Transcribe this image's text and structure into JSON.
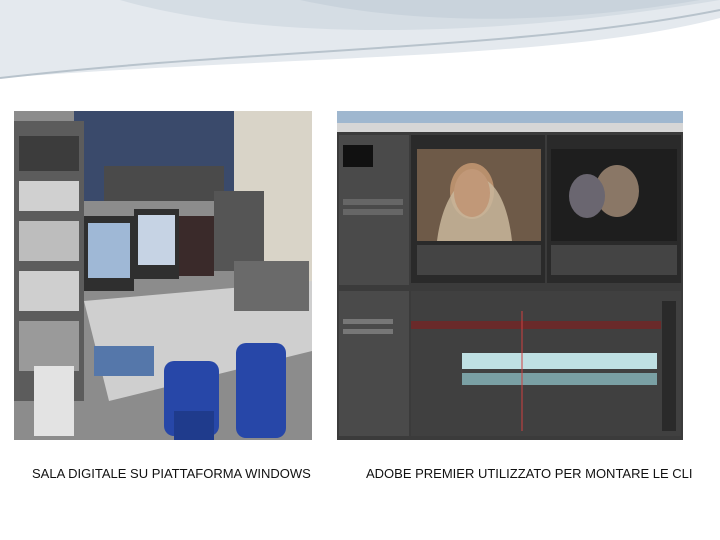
{
  "slide": {
    "images": [
      {
        "icon": "studio-photo-icon",
        "caption": "SALA DIGITALE SU PIATTAFORMA WINDOWS"
      },
      {
        "icon": "premiere-screenshot-icon",
        "caption": "ADOBE PREMIER UTILIZZATO PER MONTARE LE CLI"
      }
    ]
  },
  "colors": {
    "header_swoosh": "#c9d3dc",
    "premiere_panel": "#3b3b3b",
    "premiere_timeline": "#bfe0e3",
    "chair_blue": "#2747a8"
  }
}
